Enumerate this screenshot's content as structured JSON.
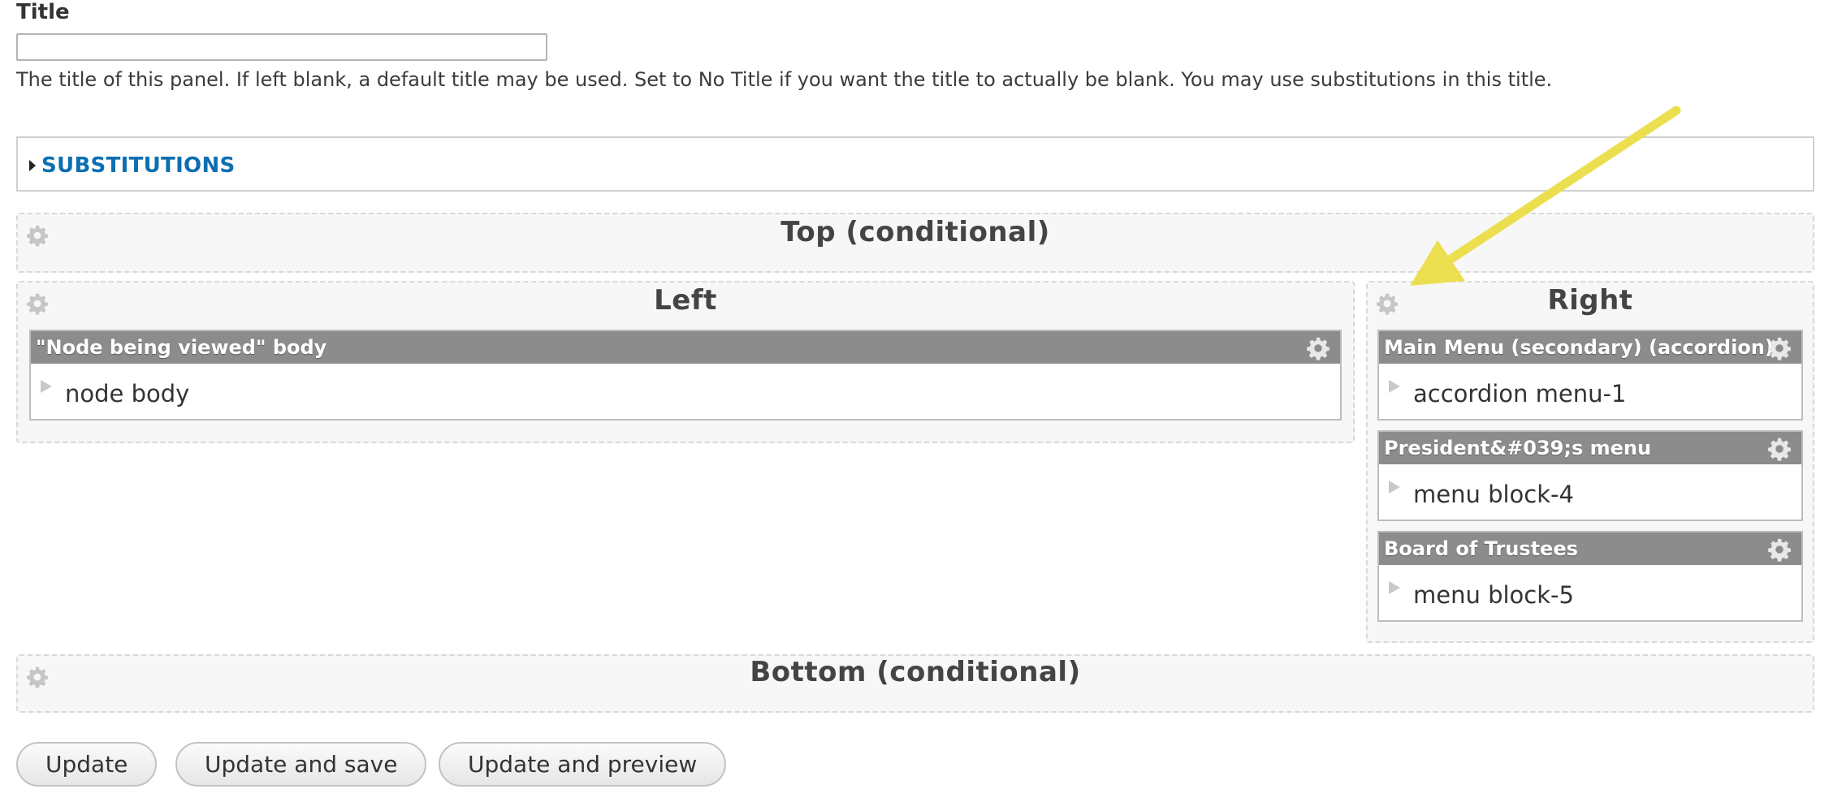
{
  "title_field": {
    "label": "Title",
    "value": "",
    "description": "The title of this panel. If left blank, a default title may be used. Set to No Title if you want the title to actually be blank. You may use substitutions in this title."
  },
  "substitutions": {
    "label": "SUBSTITUTIONS"
  },
  "regions": {
    "top": {
      "title": "Top (conditional)"
    },
    "left": {
      "title": "Left"
    },
    "right": {
      "title": "Right"
    },
    "bottom": {
      "title": "Bottom (conditional)"
    }
  },
  "panes": {
    "left": [
      {
        "title": "\"Node being viewed\" body",
        "content": "node body"
      }
    ],
    "right": [
      {
        "title": "Main Menu (secondary) (accordion)",
        "content": "accordion menu-1"
      },
      {
        "title": "President&#039;s menu",
        "content": "menu block-4"
      },
      {
        "title": "Board of Trustees",
        "content": "menu block-5"
      }
    ]
  },
  "buttons": {
    "update": "Update",
    "update_save": "Update and save",
    "update_preview": "Update and preview"
  },
  "colors": {
    "link": "#0b6fb1",
    "pane_header": "#8c8c8c",
    "annotation_arrow": "#ecdf4f"
  }
}
